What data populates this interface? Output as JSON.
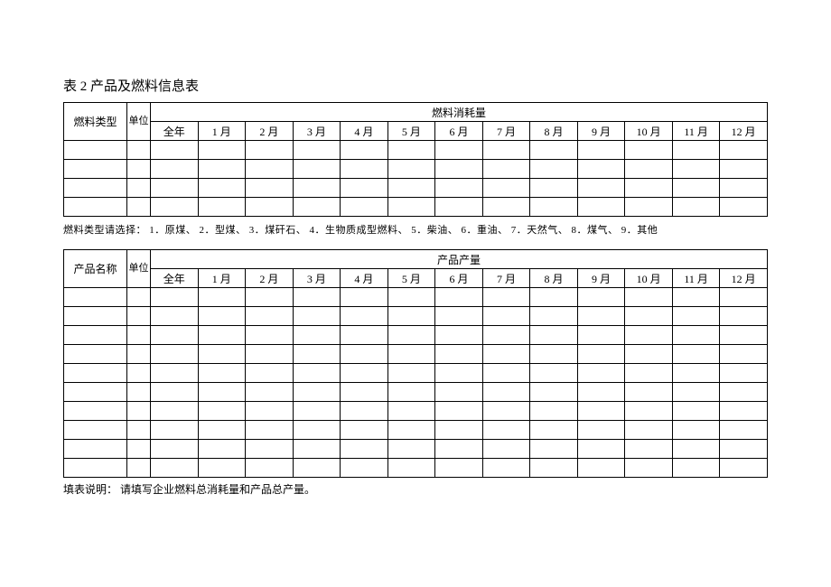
{
  "title": "表 2 产品及燃料信息表",
  "table1": {
    "rowHeader": "燃料类型",
    "unit": "单位",
    "groupHeader": "燃料消耗量",
    "columns": [
      "全年",
      "1 月",
      "2 月",
      "3 月",
      "4 月",
      "5 月",
      "6 月",
      "7 月",
      "8 月",
      "9 月",
      "10 月",
      "11 月",
      "12 月"
    ]
  },
  "note1": "燃料类型请选择：  1．原煤、 2．型煤、 3．煤矸石、 4．生物质成型燃料、  5．柴油、 6．重油、 7．天然气、 8．煤气、 9．其他",
  "table2": {
    "rowHeader": "产品名称",
    "unit": "单位",
    "groupHeader": "产品产量",
    "columns": [
      "全年",
      "1 月",
      "2 月",
      "3 月",
      "4 月",
      "5 月",
      "6 月",
      "7 月",
      "8 月",
      "9 月",
      "10 月",
      "11 月",
      "12 月"
    ]
  },
  "footer": "填表说明：  请填写企业燃料总消耗量和产品总产量。"
}
